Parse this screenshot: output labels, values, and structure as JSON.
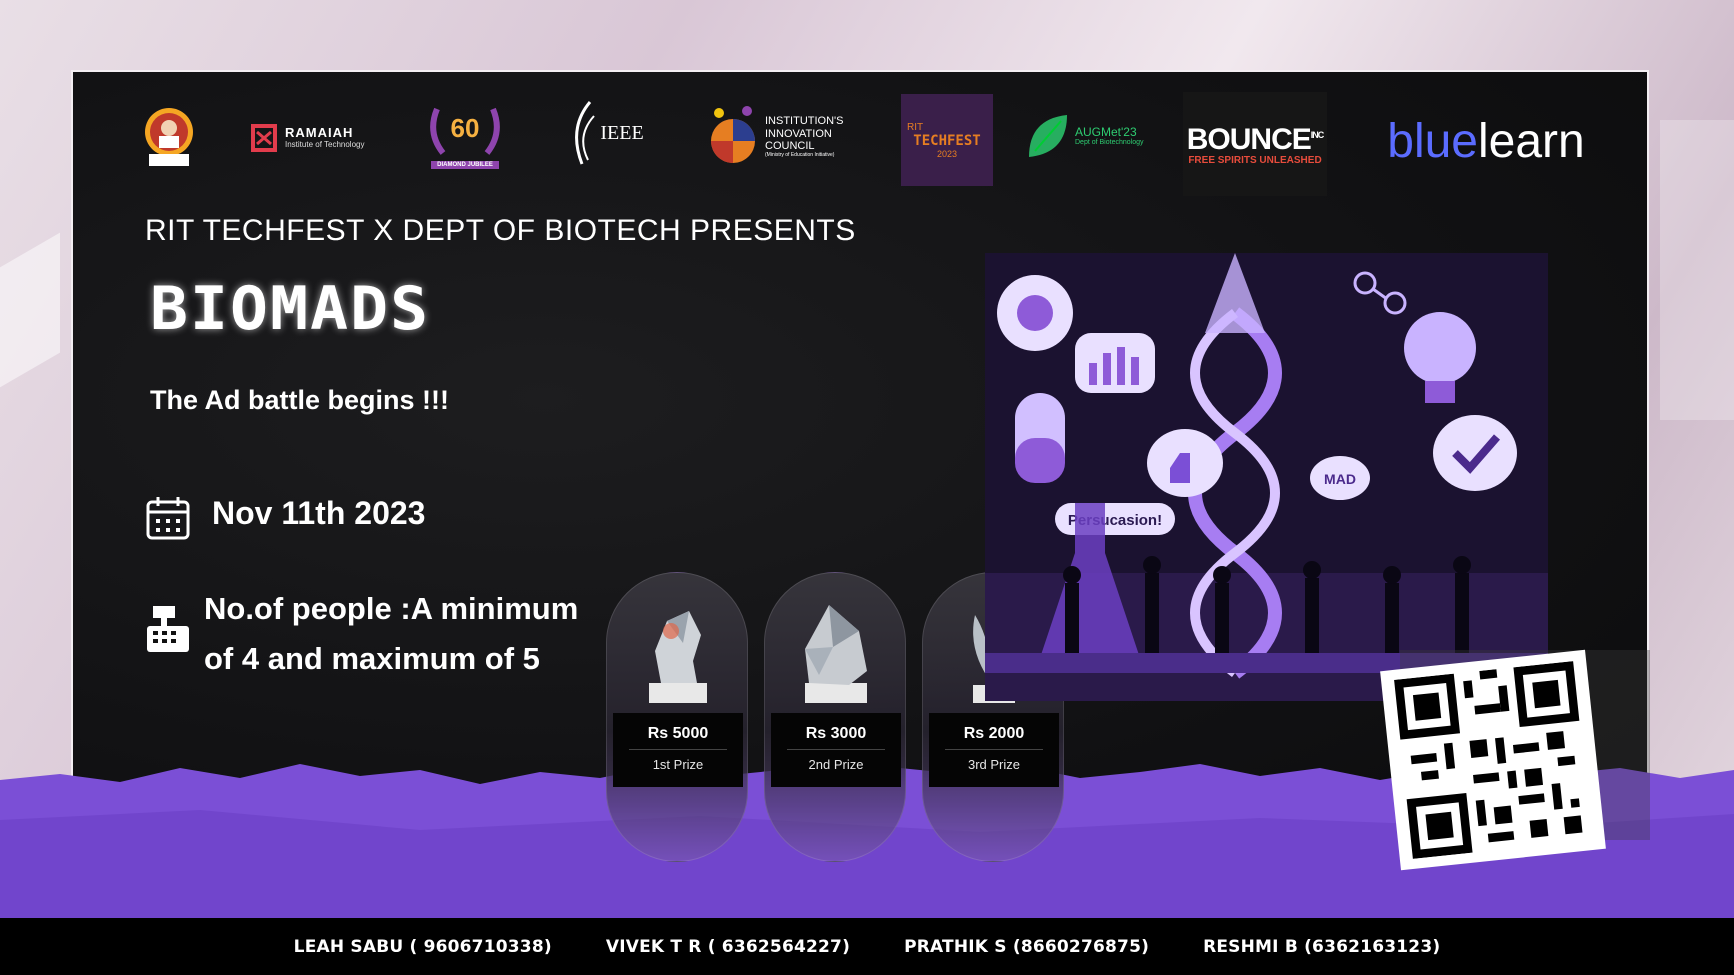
{
  "logos": {
    "ramaiah_name": "RAMAIAH",
    "ramaiah_sub": "Institute of Technology",
    "jubilee_number": "60",
    "jubilee_label": "DIAMOND JUBILEE",
    "ieee": "IEEE",
    "iic_line1": "INSTITUTION'S",
    "iic_line2": "INNOVATION",
    "iic_line3": "COUNCIL",
    "iic_line4": "(Ministry of Education Initiative)",
    "techfest_top": "RIT",
    "techfest_main": "TECHFEST",
    "techfest_year": "2023",
    "augmet_title": "AUGMet'23",
    "augmet_sub": "Dept of Biotechnology",
    "bounce_title": "BOUNCE",
    "bounce_inc": "INC",
    "bounce_sub": "FREE SPIRITS UNLEASHED",
    "bluelearn_blue": "blue",
    "bluelearn_white": "learn"
  },
  "event": {
    "presents": "RIT TECHFEST X DEPT OF BIOTECH PRESENTS",
    "title": "BIOMADS",
    "tagline": "The Ad battle begins !!!",
    "date": "Nov 11th 2023",
    "people_line1": "No.of people :A minimum",
    "people_line2": "of 4 and maximum of 5"
  },
  "prizes": [
    {
      "amount": "Rs 5000",
      "rank": "1st Prize"
    },
    {
      "amount": "Rs 3000",
      "rank": "2nd Prize"
    },
    {
      "amount": "Rs 2000",
      "rank": "3rd Prize"
    }
  ],
  "art": {
    "bubble_persuasion": "Persucasion!",
    "bubble_mad": "MAD"
  },
  "contacts": [
    "LEAH SABU ( 9606710338)",
    "VIVEK T R  ( 6362564227)",
    "PRATHIK S (8660276875)",
    "RESHMI B (6362163123)"
  ],
  "colors": {
    "accent_purple": "#7b4fd6",
    "panel_bg": "#111113",
    "bluelearn_blue": "#5b6cff"
  }
}
